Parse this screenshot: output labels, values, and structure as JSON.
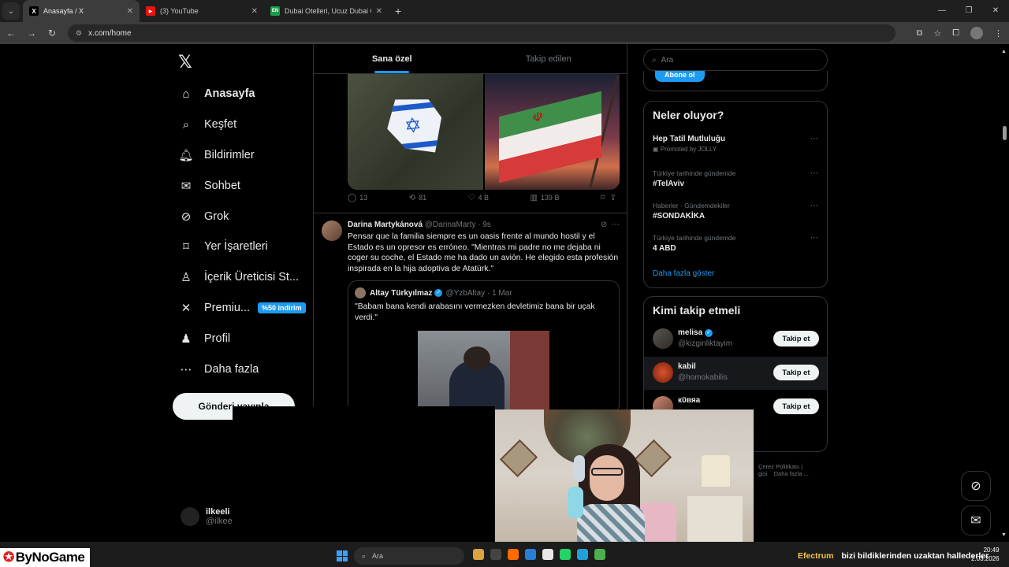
{
  "browser": {
    "tabs": [
      {
        "title": "Anasayfa / X",
        "favicon": "X"
      },
      {
        "title": "(3) YouTube",
        "favicon": "▶"
      },
      {
        "title": "Dubai Otelleri, Ucuz Dubai Otel",
        "favicon": "EN"
      }
    ],
    "url": "x.com/home"
  },
  "sidebar": {
    "items": [
      {
        "label": "Anasayfa",
        "icon": "home-icon",
        "glyph": "⌂"
      },
      {
        "label": "Keşfet",
        "icon": "search-icon",
        "glyph": "⌕"
      },
      {
        "label": "Bildirimler",
        "icon": "bell-icon",
        "glyph": "♫"
      },
      {
        "label": "Sohbet",
        "icon": "mail-icon",
        "glyph": "✉"
      },
      {
        "label": "Grok",
        "icon": "grok-icon",
        "glyph": "⊘"
      },
      {
        "label": "Yer İşaretleri",
        "icon": "bookmark-icon",
        "glyph": "⌑"
      },
      {
        "label": "İçerik Üreticisi St...",
        "icon": "creator-icon",
        "glyph": "♙"
      },
      {
        "label": "Premiu...",
        "icon": "x-premium-icon",
        "glyph": "✕",
        "badge": "%50 indirim"
      },
      {
        "label": "Profil",
        "icon": "profile-icon",
        "glyph": "♟"
      },
      {
        "label": "Daha fazla",
        "icon": "more-icon",
        "glyph": "⋯"
      }
    ],
    "post_button": "Gönderi yayınla",
    "account": {
      "name": "ilkeeli",
      "handle": "@ilkeeli"
    }
  },
  "feed": {
    "tabs": [
      "Sana özel",
      "Takip edilen"
    ],
    "tweet1_actions": {
      "replies": "13",
      "reposts": "81",
      "likes": "4 B",
      "views": "139 B"
    },
    "tweet2": {
      "name": "Darina Martykánová",
      "handle": "@DarinaMarty",
      "time": "9s",
      "text": "Pensar que la familia siempre es un oasis frente al mundo hostil y el Estado es un opresor es erróneo. \"Mientras mi padre no me dejaba ni coger su coche, el Estado me ha dado un avión. He elegido esta profesión inspirada en la hija adoptiva de Atatürk.\"",
      "quote": {
        "name": "Altay Türkyılmaz",
        "handle": "@YzbAltay",
        "time": "1 Mar",
        "text": "\"Babam bana kendi arabasını vermezken devletimiz bana bir uçak verdi.\""
      }
    }
  },
  "right": {
    "search_placeholder": "Ara",
    "premium_button": "Abone ol",
    "trends_title": "Neler oluyor?",
    "trends": [
      {
        "context": "",
        "title": "Hep Tatil Mutluluğu",
        "promo": "Promoted by JOLLY"
      },
      {
        "context": "Türkiye tarihinde gündemde",
        "title": "#TelAviv"
      },
      {
        "context": "Haberler · Gündemdekiler",
        "title": "#SONDAKİKA"
      },
      {
        "context": "Türkiye tarihinde gündemde",
        "title": "4 ABD"
      }
    ],
    "show_more": "Daha fazla göster",
    "follow_title": "Kimi takip etmeli",
    "follow": [
      {
        "name": "melisa",
        "handle": "@kizginliktayim",
        "verified": true,
        "button": "Takip et"
      },
      {
        "name": "kabil",
        "handle": "@homokabilis",
        "verified": false,
        "button": "Takip et"
      },
      {
        "name": "кϋвяа",
        "handle": "",
        "verified": false,
        "button": "Takip et"
      }
    ],
    "footer": [
      "Çerez Politikası",
      "|",
      "gisi",
      "Daha fazla ..."
    ]
  },
  "stream": {
    "brand": "ByNoGame",
    "ticker_highlight": "Efectrum",
    "ticker_text": "bizi bildiklerinden uzaktan hallederler",
    "taskbar_search": "Ara",
    "clock_time": "20:49",
    "clock_date": "2.03.2026"
  },
  "colors": {
    "accent": "#1d9bf0",
    "background": "#000000",
    "border": "#2f3336"
  }
}
